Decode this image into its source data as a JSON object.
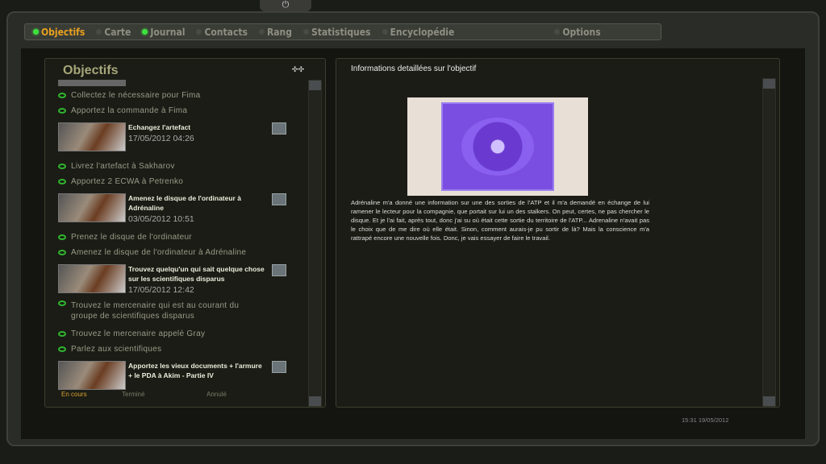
{
  "tabs": [
    {
      "label": "Objectifs",
      "active": true,
      "led": true
    },
    {
      "label": "Carte",
      "active": false,
      "led": false
    },
    {
      "label": "Journal",
      "active": false,
      "led": true
    },
    {
      "label": "Contacts",
      "active": false,
      "led": false
    },
    {
      "label": "Rang",
      "active": false,
      "led": false
    },
    {
      "label": "Statistiques",
      "active": false,
      "led": false
    },
    {
      "label": "Encyclopédie",
      "active": false,
      "led": false
    },
    {
      "label": "Options",
      "active": false,
      "led": false
    }
  ],
  "left": {
    "title": "Objectifs",
    "items": [
      {
        "type": "sub",
        "text": "Collectez le nécessaire pour Fima"
      },
      {
        "type": "sub",
        "text": "Apportez la commande à Fima"
      },
      {
        "type": "quest",
        "title": "Echangez l'artefact",
        "date": "17/05/2012  04:26"
      },
      {
        "type": "sub",
        "text": "Livrez l'artefact à Sakharov"
      },
      {
        "type": "sub",
        "text": "Apportez 2 ECWA à Petrenko"
      },
      {
        "type": "quest",
        "title": "Amenez le disque de l'ordinateur à Adrénaline",
        "date": "03/05/2012  10:51"
      },
      {
        "type": "sub",
        "text": "Prenez le disque de l'ordinateur"
      },
      {
        "type": "sub",
        "text": "Amenez le disque de l'ordinateur à Adrénaline"
      },
      {
        "type": "quest",
        "title": "Trouvez quelqu'un qui sait quelque chose sur les scientifiques disparus",
        "date": "17/05/2012  12:42"
      },
      {
        "type": "sub",
        "text": "Trouvez le mercenaire qui est au courant du groupe de scientifiques disparus"
      },
      {
        "type": "sub",
        "text": "Trouvez le mercenaire appelé Gray"
      },
      {
        "type": "sub",
        "text": "Parlez aux scientifiques"
      },
      {
        "type": "quest",
        "title": "Apportez les vieux documents + l'armure + le PDA à Akim - Partie IV",
        "date": ""
      }
    ],
    "filters": [
      "En cours",
      "Terminé",
      "Annulé"
    ]
  },
  "right": {
    "title": "Informations detaillées sur l'objectif",
    "description": "Adrénaline m'a donné une information sur une des sorties de l'ATP et il m'a demandé en échange de lui ramener le lecteur pour la compagnie, que portait sur lui un des stalkers. On peut, certes, ne pas chercher le disque. Et je l'ai fait, après tout, donc j'ai su où était cette sortie du territoire de l'ATP... Adrenaline n'avait pas le choix que de me dire où elle était. Sinon, comment aurais-je pu sortir de là? Mais la conscience m'a rattrapé encore une nouvelle fois. Donc, je vais essayer de faire le travail."
  },
  "clock": "15:31  19/05/2012",
  "colors": {
    "active_tab": "#e8a020",
    "led": "#3ee03e",
    "title": "#a6a77a"
  }
}
